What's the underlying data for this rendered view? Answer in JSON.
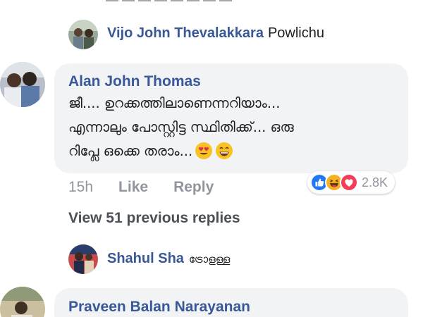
{
  "replies": [
    {
      "author": "Vijo John Thevalakkara",
      "text": "Powlichu"
    },
    {
      "author": "Shahul Sha",
      "text": "ട്രോളള്ള"
    }
  ],
  "main_comment": {
    "author": "Alan John Thomas",
    "text_line1": "ജീ.... ഉറക്കത്തിലാണെന്നറിയാം...",
    "text_line2": "എന്നാലും പോസ്റ്റിട്ട സ്ഥിതിക്ക്... ഒരു",
    "text_line3": "റിപ്ലേ ഒക്കെ തരാം...",
    "emojis": [
      "heart-eyes-emoji-icon",
      "grinning-emoji-icon"
    ],
    "time": "15h",
    "like_label": "Like",
    "reply_label": "Reply",
    "reaction_icons": [
      "like-reaction-icon",
      "haha-reaction-icon",
      "love-reaction-icon"
    ],
    "reaction_count": "2.8K"
  },
  "view_previous": "View 51 previous replies",
  "next_comment": {
    "author": "Praveen Balan Narayanan"
  },
  "colors": {
    "name": "#385898",
    "bubble": "#f2f3f5",
    "meta": "#90949c",
    "like_blue": "#2078f4",
    "love_red": "#f33e58",
    "haha_yellow": "#f7b125"
  }
}
